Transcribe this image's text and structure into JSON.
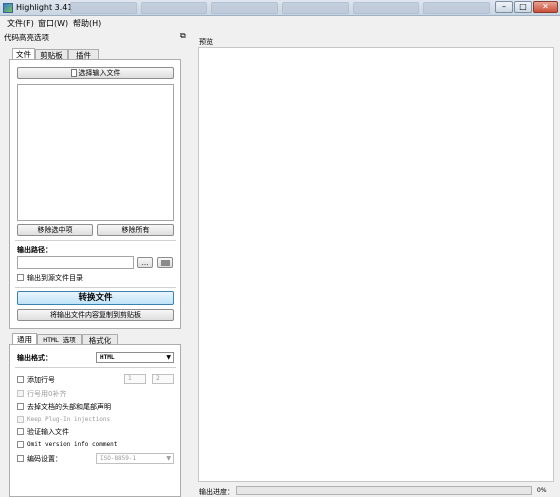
{
  "window": {
    "title": "Highlight 3.41",
    "controls": [
      "–",
      "□",
      "✕"
    ]
  },
  "menu": [
    {
      "label": "文件(F)"
    },
    {
      "label": "窗口(W)"
    },
    {
      "label": "帮助(H)"
    }
  ],
  "dock": {
    "title": "代码高亮选项",
    "float_glyph": "⧉"
  },
  "top_tabs": [
    {
      "label": "文件"
    },
    {
      "label": "剪贴板"
    },
    {
      "label": "插件"
    }
  ],
  "file_tab": {
    "select_input_label": "选择输入文件",
    "remove_selected_label": "移除选中项",
    "remove_all_label": "移除所有",
    "output_path_label": "输出路径：",
    "output_path_value": "",
    "browse_label": "...",
    "output_to_source_label": "输出到源文件目录",
    "convert_label": "转换文件",
    "copy_to_clipboard_label": "将输出文件内容复制到剪贴板"
  },
  "bottom_tabs": [
    {
      "label": "通用"
    },
    {
      "label": "HTML 选项"
    },
    {
      "label": "格式化"
    }
  ],
  "general": {
    "output_format_label": "输出格式：",
    "output_format_value": "HTML",
    "line_numbers_label": "添加行号",
    "line_number_start": "1",
    "line_number_width": "2",
    "zero_pad_label": "行号用0补齐",
    "omit_header_footer_label": "去掉文档的头部和尾部声明",
    "keep_plugin_label": "Keep Plug-In injections",
    "validate_input_label": "验证输入文件",
    "omit_version_label": "Omit version info comment",
    "encoding_label": "编码设置：",
    "encoding_value": "ISO-8859-1"
  },
  "preview": {
    "label": "预览"
  },
  "progress": {
    "label": "输出进度：",
    "value": 0,
    "value_text": "0%"
  }
}
